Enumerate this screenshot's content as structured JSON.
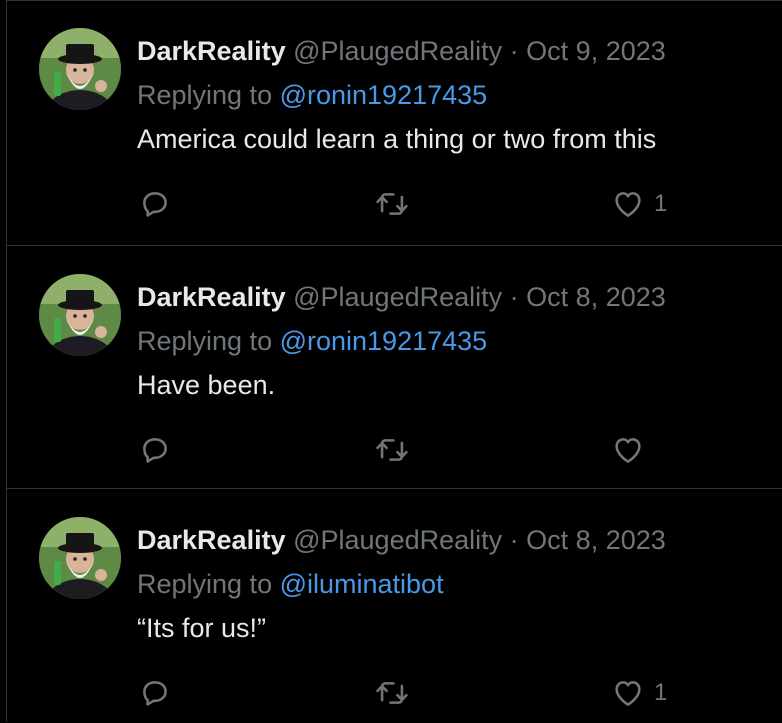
{
  "tweets": [
    {
      "name": "DarkReality",
      "handle": "@PlaugedReality",
      "separator": "·",
      "date": "Oct 9, 2023",
      "replying_prefix": "Replying to ",
      "replying_to": "@ronin19217435",
      "text": "America could learn a thing or two from this",
      "like_count": "1"
    },
    {
      "name": "DarkReality",
      "handle": "@PlaugedReality",
      "separator": "·",
      "date": "Oct 8, 2023",
      "replying_prefix": "Replying to ",
      "replying_to": "@ronin19217435",
      "text": "Have been.",
      "like_count": ""
    },
    {
      "name": "DarkReality",
      "handle": "@PlaugedReality",
      "separator": "·",
      "date": "Oct 8, 2023",
      "replying_prefix": "Replying to ",
      "replying_to": "@iluminatibot",
      "text": "“Its for us!”",
      "like_count": "1"
    }
  ],
  "icons": {
    "reply": "reply-icon",
    "retweet": "retweet-icon",
    "like": "heart-icon"
  },
  "colors": {
    "background": "#000000",
    "text": "#e7e9ea",
    "muted": "#71767b",
    "mention": "#4a99e9",
    "divider": "#2f3336"
  }
}
